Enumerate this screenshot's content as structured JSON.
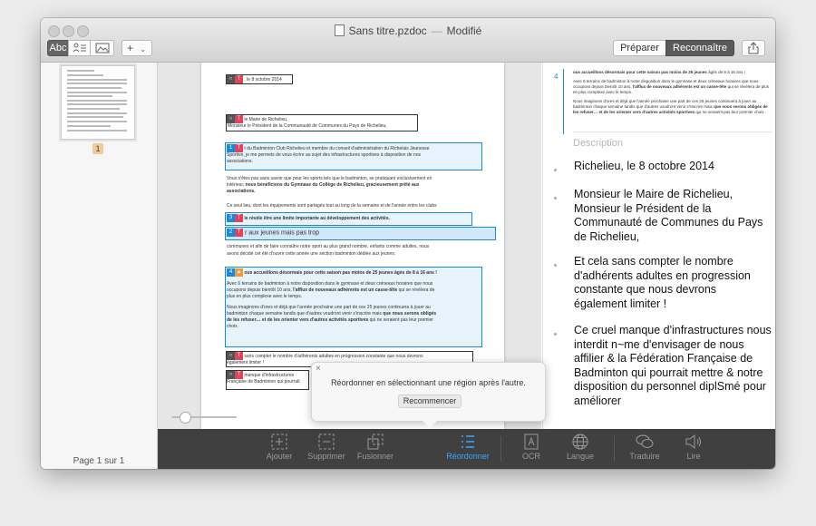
{
  "window": {
    "title": "Sans titre.pzdoc",
    "separator": "—",
    "status": "Modifié"
  },
  "toolbar_top": {
    "view_text_label": "Abc",
    "add_label": "+",
    "prepare_label": "Préparer",
    "recognize_label": "Reconnaître"
  },
  "sidebar": {
    "page_badge": "1",
    "page_count": "Page 1 sur 1"
  },
  "document": {
    "date_line": ", le 8 octobre 2014",
    "addr_1": "le Maire de Richelieu,",
    "addr_2": "Monsieur le Président de la Communauté de Communes du Pays de Richelieu,",
    "para_1_frag1": "t du Badminton Club Richelieu et membre du conseil d'administration du Richelais Jeunesse",
    "para_1_frag2": "Sportive, je me permets de vous écrire au sujet des infrastructures sportives à disposition de nos",
    "para_1_frag3": "associations.",
    "para_2a": "Vous n'êtes pas sans savoir que pour les sports tels que le badminton, se pratiquant exclusivement en",
    "para_2b": "intérieur,",
    "para_2c": "nous bénéficions du Gymnase du Collège de Richelieu, gracieusement prêté aux",
    "para_2d": "associations.",
    "para_3": "Ce seul lieu, dont les équipements sont partagés tout au long de la semaine et de l'année entre les clubs",
    "box3_text": "le révèle être une limite importante au développement des activités.",
    "box2_text": "r aux jeunes mais pas trop",
    "para_4": "communes et afin de faire connaître notre sport au plus grand nombre, enfants comme adultes, nous",
    "para_5": "avons décidé cet été d'ouvrir cette année une section badminton dédiée aux jeunes.",
    "box4_head": "ous accueillons désormais pour cette saison pas moins de 25 jeunes âgés de 8 à 16 ans !",
    "box4_p1": "Avec 6 terrains de badminton à notre disposition dans le gymnase et deux créneaux horaires que nous",
    "box4_p2a": "occupons depuis bientôt 10 ans,",
    "box4_p2b": "l'afflux de nouveaux adhérents est un casse-tête",
    "box4_p2c": "qui se révèlera de",
    "box4_p3": "plus en plus complexe avec le temps.",
    "box4_p4": "Nous imaginons d'ores et déjà que l'année prochaine une part de ces 25 jeunes continuera à jouer au",
    "box4_p5a": "badminton chaque semaine tandis que d'autres voudront venir s'inscrire mais",
    "box4_p5b": "que nous serons obligés",
    "box4_p6a": "de les refuser… et de les orienter vers d'autres activités sportives",
    "box4_p6b": "qui ne seraient pas leur premier",
    "box4_p7": "choix.",
    "last_1": "sans compter le nombre d'adhérents adultes en progression constante que nous devrons",
    "last_2": "également limiter !",
    "last_3a": "manque d'infrastructures",
    "last_3b": "Française de Badminton qui pourrait"
  },
  "popover": {
    "message": "Réordonner en sélectionnant une région après l'autre.",
    "button": "Recommencer",
    "close": "×"
  },
  "right_panel": {
    "preview_number": "4",
    "preview_1a": "ous accueillons désormais pour cette saison pas moins de 25 jeunes",
    "preview_1b": "âgés de 8 à 16 ans !",
    "preview_2": "Avec 6 terrains de badminton à notre disposition dans le gymnase et deux créneaux horaires que nous occupons depuis bientôt 10 ans,",
    "preview_2b": "l'afflux de nouveaux adhérents est un casse-tête",
    "preview_2c": "qui se révèlera de plus en plus complexe avec le temps.",
    "preview_3": "Nous imaginons d'ores et déjà que l'année prochaine une part de ces 25 jeunes continuera à jouer au badminton chaque semaine tandis que d'autres voudront venir s'inscrire mais",
    "preview_3b": "que nous serons obligés de les refuser… et de les orienter vers d'autres activités sportives",
    "preview_3c": "qui ne seraient pas leur premier choix.",
    "description_placeholder": "Description",
    "entries": [
      "Richelieu, le 8 octobre 2014",
      "Monsieur le Maire de Richelieu, Monsieur le Président de la Communauté de Communes du Pays de Richelieu,",
      "Et cela sans compter le nombre d'adhérents adultes en progression constante que nous devrons également limiter !",
      "Ce cruel manque d'infrastructures nous interdit n~me d'envisager de nous affilier & la Fédération Française de Badminton qui pourrait mettre & notre disposition du personnel diplSmé pour améliorer"
    ]
  },
  "tools": [
    {
      "label": "Ajouter",
      "icon": "add-region-icon"
    },
    {
      "label": "Supprimer",
      "icon": "remove-region-icon"
    },
    {
      "label": "Fusionner",
      "icon": "merge-icon"
    },
    {
      "label": "Réordonner",
      "icon": "reorder-icon"
    },
    {
      "label": "OCR",
      "icon": "ocr-icon"
    },
    {
      "label": "Langue",
      "icon": "globe-icon"
    },
    {
      "label": "Traduire",
      "icon": "speech-bubbles-icon"
    },
    {
      "label": "Lire",
      "icon": "speaker-icon"
    }
  ],
  "colors": {
    "accent": "#1a8ad4",
    "toolbar": "#404040",
    "active_tool": "#3aa6ff",
    "tag_red": "#e0445a"
  }
}
